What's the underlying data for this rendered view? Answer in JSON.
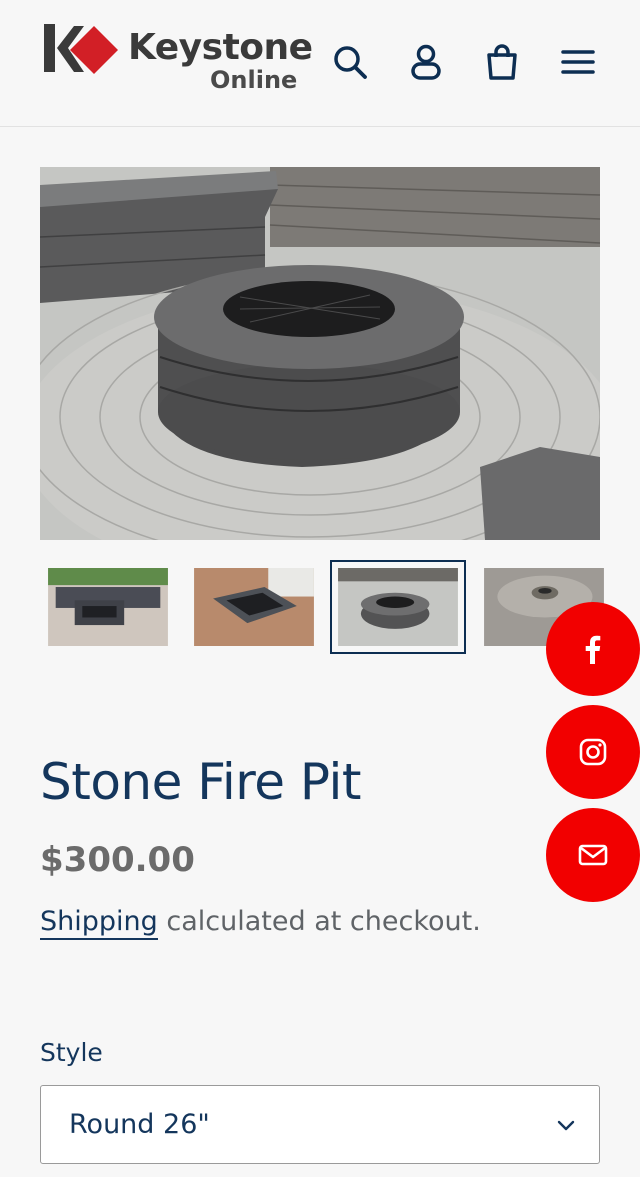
{
  "header": {
    "logo_word": "Keystone",
    "logo_sub": "Online",
    "icons": [
      "search-icon",
      "account-icon",
      "cart-icon",
      "menu-icon"
    ],
    "accent_color": "#0d2e52"
  },
  "gallery": {
    "main_image": "round stone fire pit on circular paver patio",
    "thumbnails": [
      {
        "label": "square fire pit with seating wall"
      },
      {
        "label": "square fire pit on brick patio"
      },
      {
        "label": "round stone fire pit"
      },
      {
        "label": "fire pit on paver patio"
      }
    ],
    "active_index": 2
  },
  "social": {
    "items": [
      "facebook-icon",
      "instagram-icon",
      "mail-icon"
    ],
    "color": "#f20000"
  },
  "product": {
    "title": "Stone Fire Pit",
    "price": "$300.00",
    "shipping_link": "Shipping",
    "shipping_text": " calculated at checkout.",
    "style_label": "Style",
    "style_selected": "Round 26\""
  }
}
